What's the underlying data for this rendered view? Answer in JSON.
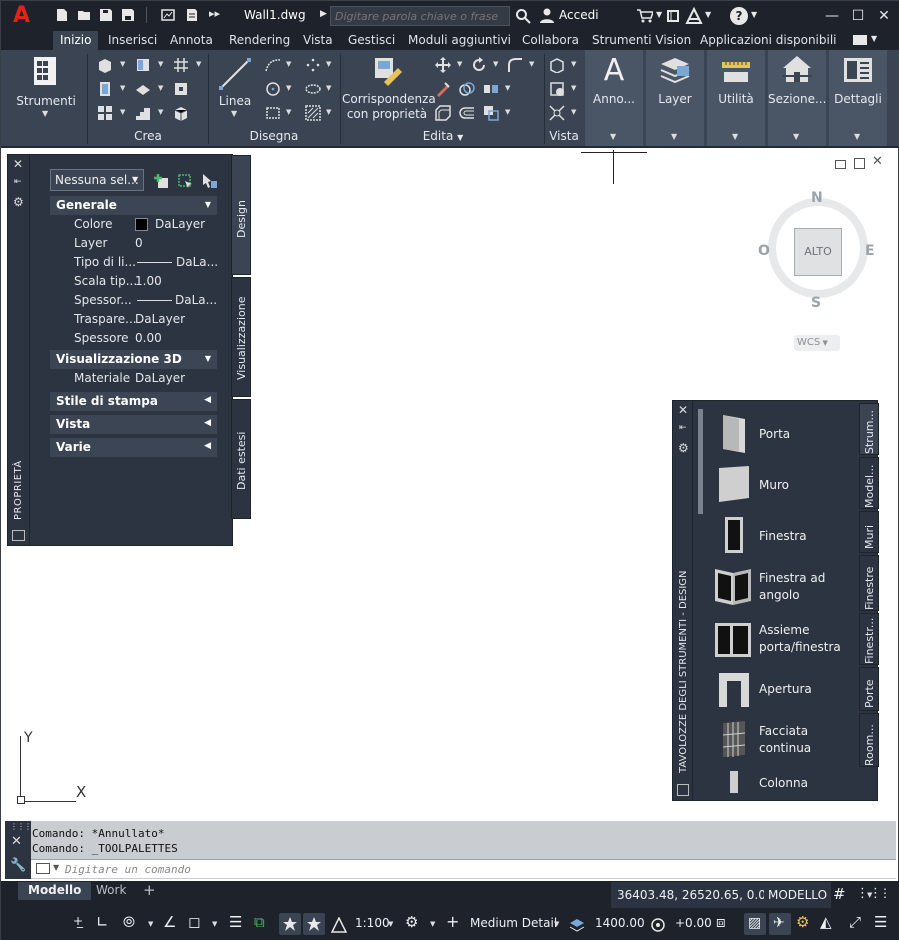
{
  "app": {
    "logo_letter": "A",
    "file_name": "Wall1.dwg",
    "search_placeholder": "Digitare parola chiave o frase",
    "login_label": "Accedi",
    "help_label": "?"
  },
  "tabs": [
    {
      "label": "Inizio",
      "active": true
    },
    {
      "label": "Inserisci"
    },
    {
      "label": "Annota"
    },
    {
      "label": "Rendering"
    },
    {
      "label": "Vista"
    },
    {
      "label": "Gestisci"
    },
    {
      "label": "Moduli aggiuntivi"
    },
    {
      "label": "Collabora"
    },
    {
      "label": "Strumenti Vision"
    },
    {
      "label": "Applicazioni disponibili"
    }
  ],
  "ribbon": {
    "strumenti_label": "Strumenti",
    "crea_title": "Crea",
    "linea_label": "Linea",
    "disegna_title": "Disegna",
    "corrispondenza_line1": "Corrispondenza",
    "corrispondenza_line2": "con proprietà",
    "edita_title": "Edita",
    "vista_title": "Vista",
    "anno_label": "Anno...",
    "layer_label": "Layer",
    "utilita_label": "Utilità",
    "sezione_label": "Sezione...",
    "dettagli_label": "Dettagli"
  },
  "properties": {
    "selection": "Nessuna sel...",
    "palette_title": "PROPRIETÀ",
    "sections": {
      "generale": "Generale",
      "vis3d": "Visualizzazione 3D",
      "stile": "Stile di stampa",
      "vista": "Vista",
      "varie": "Varie"
    },
    "rows": [
      {
        "name": "Colore",
        "value": "DaLayer"
      },
      {
        "name": "Layer",
        "value": "0"
      },
      {
        "name": "Tipo di li...",
        "value": "DaLa..."
      },
      {
        "name": "Scala tip...",
        "value": "1.00"
      },
      {
        "name": "Spessor...",
        "value": "DaLa..."
      },
      {
        "name": "Traspare...",
        "value": "DaLayer"
      },
      {
        "name": "Spessore",
        "value": "0.00"
      }
    ],
    "materiale": {
      "name": "Materiale",
      "value": "DaLayer"
    },
    "side_tabs": [
      "Design",
      "Visualizzazione",
      "Dati estesi"
    ]
  },
  "viewcube": {
    "north": "N",
    "south": "S",
    "east": "E",
    "west": "O",
    "face": "ALTO",
    "wcs": "WCS"
  },
  "ucs": {
    "x": "X",
    "y": "Y"
  },
  "tool_palette": {
    "title": "TAVOLOZZE DEGLI STRUMENTI - DESIGN",
    "items": [
      {
        "line1": "Porta",
        "line2": ""
      },
      {
        "line1": "Muro",
        "line2": ""
      },
      {
        "line1": "Finestra",
        "line2": ""
      },
      {
        "line1": "Finestra ad",
        "line2": "angolo"
      },
      {
        "line1": "Assieme",
        "line2": "porta/finestra"
      },
      {
        "line1": "Apertura",
        "line2": ""
      },
      {
        "line1": "Facciata",
        "line2": "continua"
      },
      {
        "line1": "Colonna",
        "line2": ""
      }
    ],
    "side_tabs": [
      "Strum...",
      "Model...",
      "Muri",
      "Finestre",
      "Finestr...",
      "Porte",
      "Room..."
    ]
  },
  "command": {
    "history": [
      "Comando:  *Annullato*",
      "Comando:  _TOOLPALETTES"
    ],
    "placeholder": "Digitare un comando"
  },
  "status": {
    "layout_tabs": [
      {
        "label": "Modello",
        "active": true
      },
      {
        "label": "Work"
      }
    ],
    "add_tab": "+",
    "coords": "36403.48, 26520.65, 0.00",
    "mode": "MODELLO",
    "scale": "1:100",
    "detail": "Medium Detail",
    "elevation": "1400.00",
    "offset": "+0.00"
  },
  "colors": {
    "titlebar": "#1d222b",
    "ribbon": "#3b4453",
    "palette": "#2c3441",
    "logo": "#e2231a",
    "accent": "#4a90d9"
  }
}
